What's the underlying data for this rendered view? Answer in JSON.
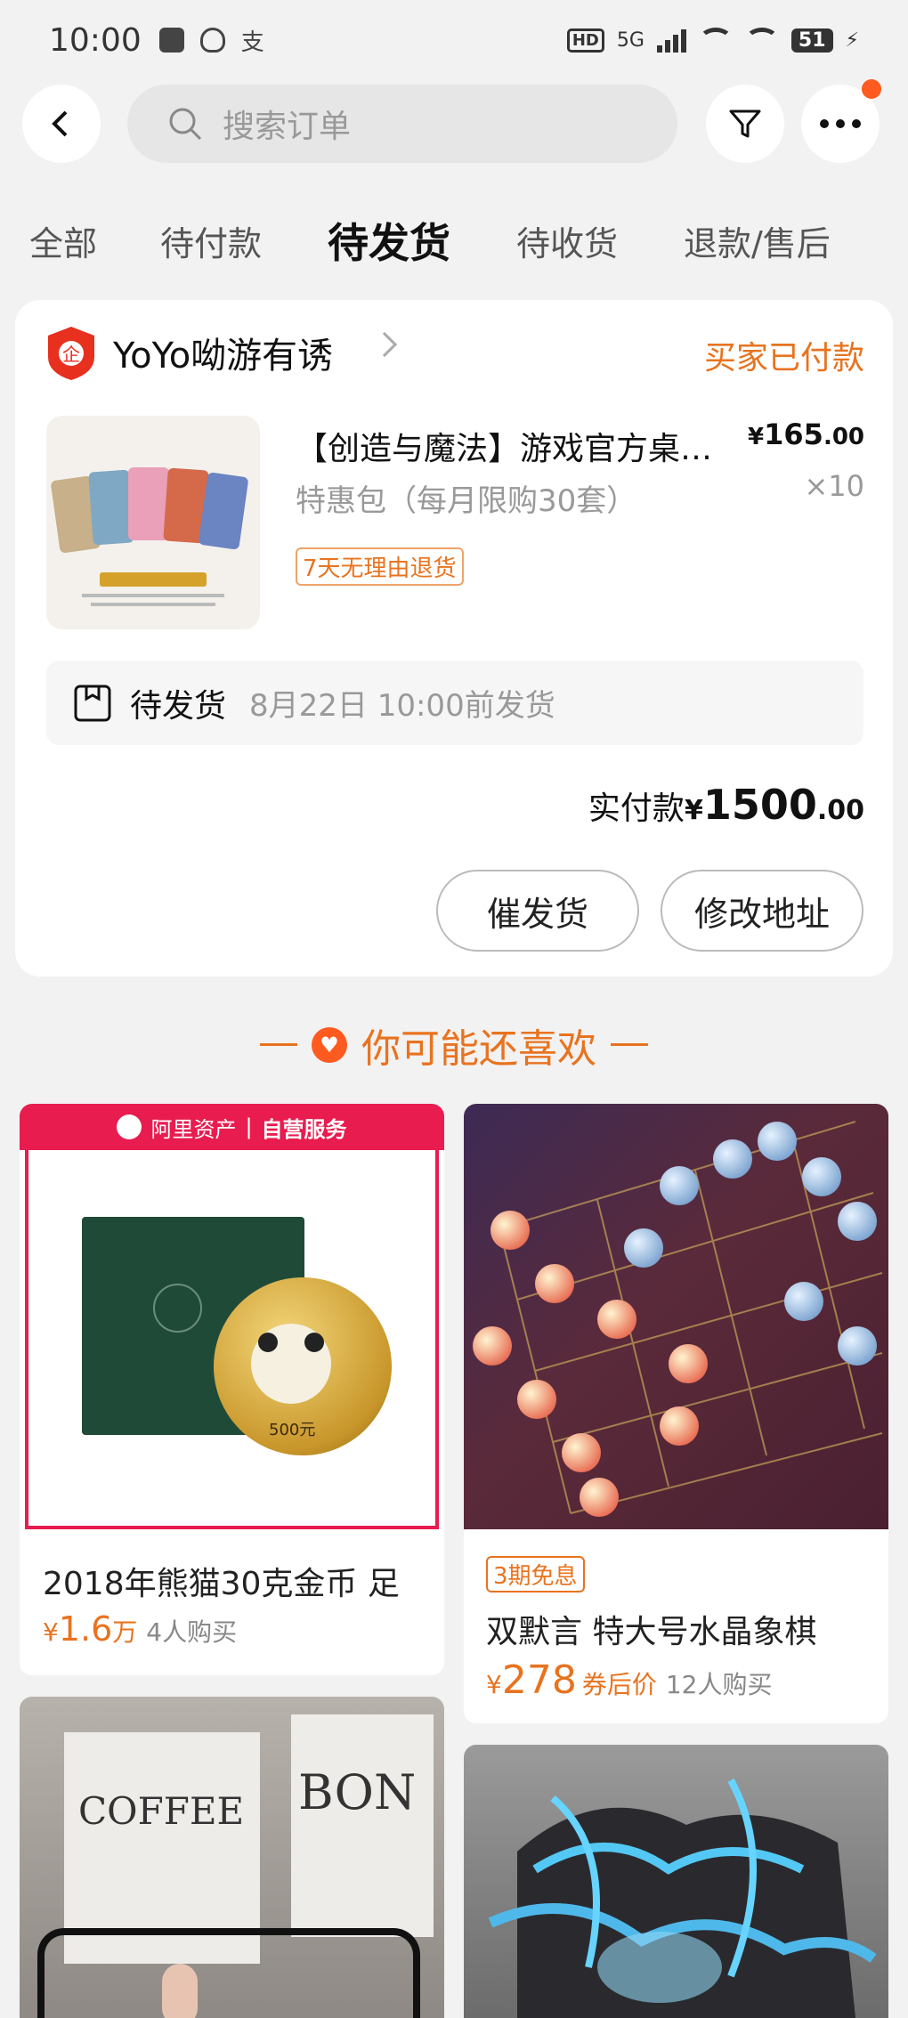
{
  "status_bar": {
    "time": "10:00",
    "network": "5G",
    "battery": "51"
  },
  "header": {
    "search_placeholder": "搜索订单"
  },
  "tabs": [
    {
      "label": "全部",
      "active": false
    },
    {
      "label": "待付款",
      "active": false
    },
    {
      "label": "待发货",
      "active": true
    },
    {
      "label": "待收货",
      "active": false
    },
    {
      "label": "退款/售后",
      "active": false
    }
  ],
  "order": {
    "shop_name": "YoYo呦游有诱",
    "status": "买家已付款",
    "product_title": "【创造与魔法】游戏官方桌游卡牌",
    "product_spec": "特惠包（每月限购30套）",
    "return_tag": "7天无理由退货",
    "price_prefix": "¥",
    "price_int": "165",
    "price_dec": ".00",
    "quantity": "×10",
    "ship_label": "待发货",
    "ship_date": "8月22日 10:00前发货",
    "total_label": "实付款",
    "total_prefix": "¥",
    "total_int": "1500",
    "total_dec": ".00",
    "buttons": {
      "remind": "催发货",
      "change_address": "修改地址"
    }
  },
  "recommend": {
    "title": "你可能还喜欢",
    "items": [
      {
        "banner_brand": "阿里资产",
        "banner_service": "自营服务",
        "title": "2018年熊猫30克金币 足",
        "price_prefix": "¥",
        "price": "1.6",
        "price_unit": "万",
        "buyers": "4人购买",
        "coin_label": "500元"
      },
      {
        "tag": "3期免息",
        "title": "双默言 特大号水晶象棋",
        "price_prefix": "¥",
        "price": "278",
        "price_note": "券后价",
        "buyers": "12人购买"
      },
      {
        "sign1": "COFFEE",
        "sign2": "BON"
      }
    ]
  },
  "colors": {
    "accent": "#e8731f",
    "ali_red": "#e81c4f",
    "notify_dot": "#ff5a1f"
  }
}
